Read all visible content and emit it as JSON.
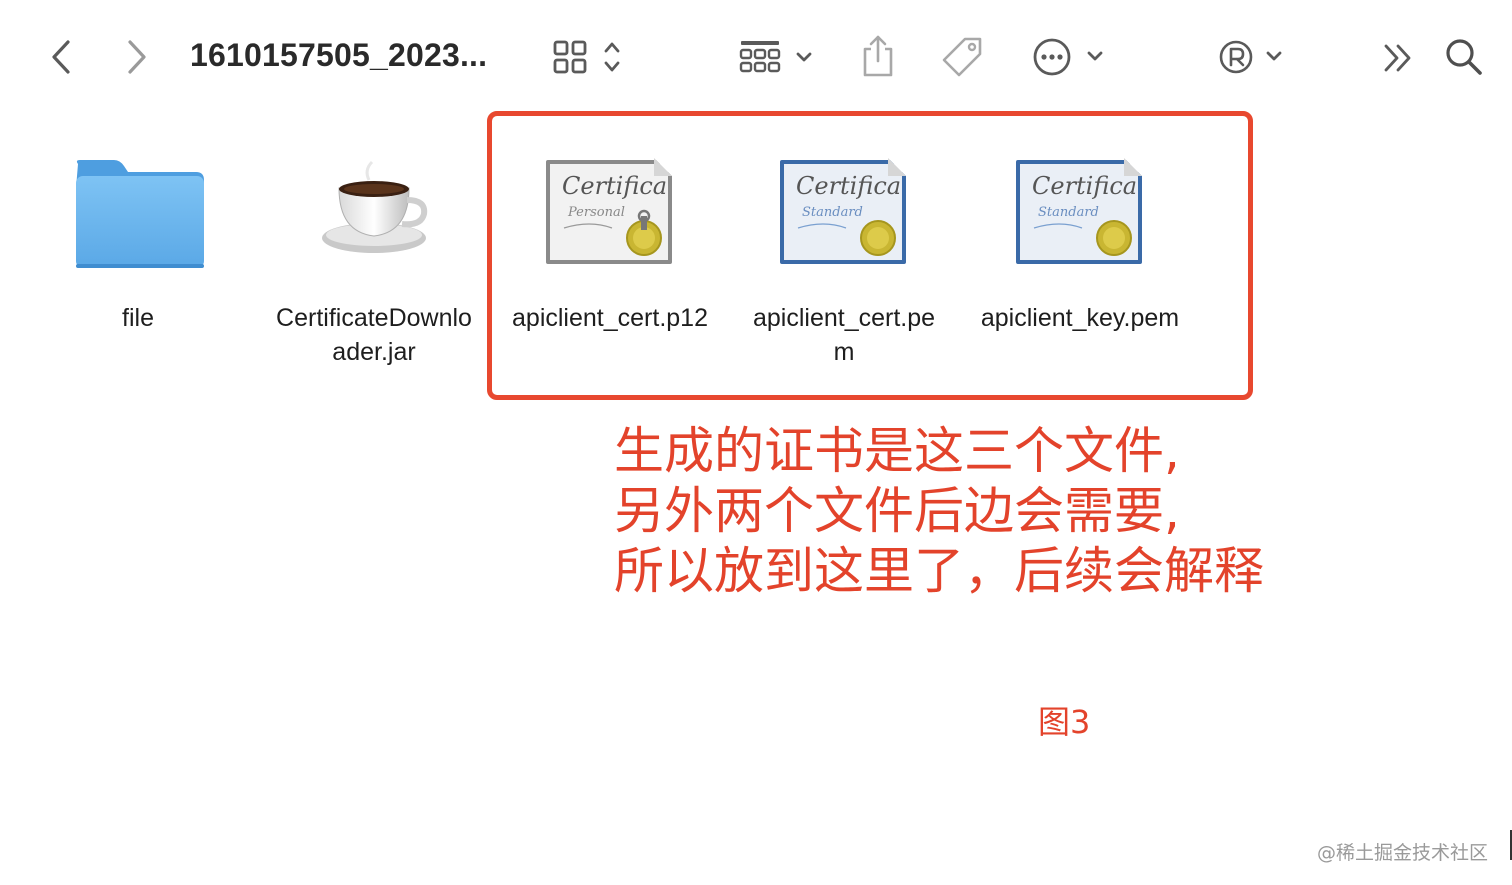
{
  "window": {
    "title": "1610157505_2023..."
  },
  "toolbar": {
    "back_icon": "chevron-left-icon",
    "forward_icon": "chevron-right-icon",
    "view_icon": "icon-grid-view-icon",
    "group_icon": "group-by-icon",
    "share_icon": "share-icon",
    "tag_icon": "tag-icon",
    "more_icon": "ellipsis-circle-icon",
    "registered_icon": "registered-icon",
    "overflow_icon": "chevron-double-right-icon",
    "search_icon": "search-icon"
  },
  "files": [
    {
      "name": "file",
      "icon": "folder-icon"
    },
    {
      "name": "CertificateDownloader.jar",
      "line1": "CertificateDownlo",
      "line2": "ader.jar",
      "icon": "java-coffee-cup-icon"
    },
    {
      "name": "apiclient_cert.p12",
      "icon": "certificate-personal-icon",
      "cert_title": "Certifica",
      "cert_sub": "Personal"
    },
    {
      "name": "apiclient_cert.pem",
      "line1": "apiclient_cert.pe",
      "line2": "m",
      "icon": "certificate-standard-icon",
      "cert_title": "Certifica",
      "cert_sub": "Standard"
    },
    {
      "name": "apiclient_key.pem",
      "icon": "certificate-standard-icon",
      "cert_title": "Certifica",
      "cert_sub": "Standard"
    }
  ],
  "annotation": {
    "lines": [
      "生成的证书是这三个文件,",
      "另外两个文件后边会需要,",
      "所以放到这里了，后续会解释"
    ],
    "figure_label": "图3",
    "color": "#e3432b"
  },
  "watermark": "@稀土掘金技术社区"
}
